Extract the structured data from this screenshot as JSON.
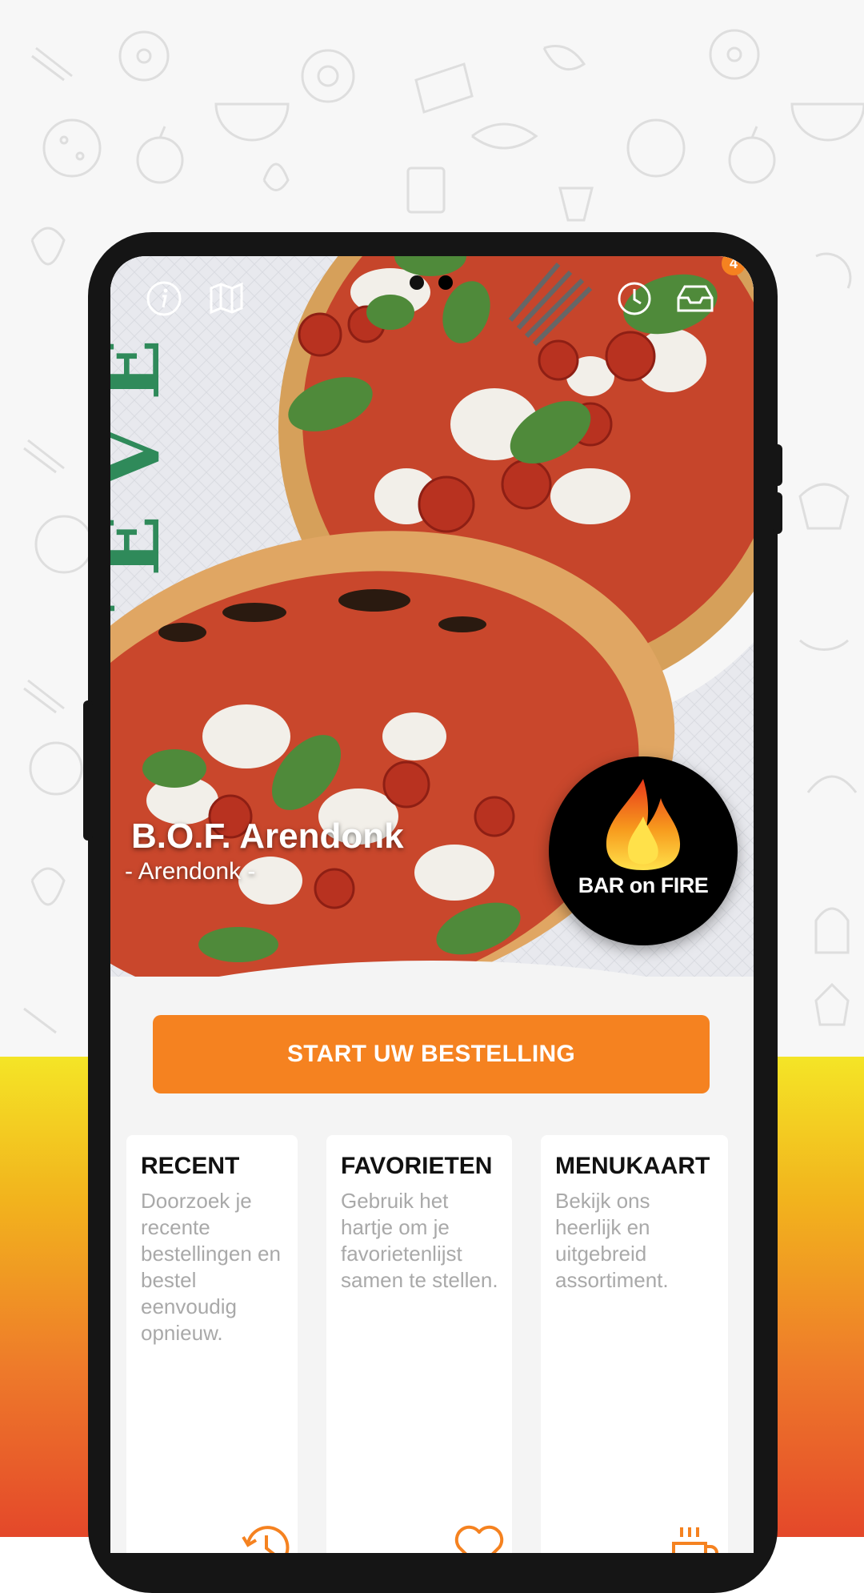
{
  "restaurant": {
    "name": "B.O.F. Arendonk",
    "city": "- Arendonk -",
    "logo_text": "BAR on FIRE"
  },
  "top_icons": [
    "info-icon",
    "map-icon",
    "history-icon",
    "inbox-icon"
  ],
  "inbox_badge": "4",
  "start_button": "START UW BESTELLING",
  "cards": [
    {
      "title": "RECENT",
      "text": "Doorzoek je recente bestellingen en bestel eenvoudig opnieuw.",
      "icon": "history-icon"
    },
    {
      "title": "FAVORIETEN",
      "text": "Gebruik het hartje om je favorietenlijst samen te stellen.",
      "icon": "heart-icon"
    },
    {
      "title": "MENUKAART",
      "text": "Bekijk ons heerlijk en uitgebreid assortiment.",
      "icon": "coffee-cup-icon"
    }
  ],
  "colors": {
    "accent": "#f58220",
    "background_gradient": [
      "#f4e526",
      "#e4482a"
    ]
  }
}
